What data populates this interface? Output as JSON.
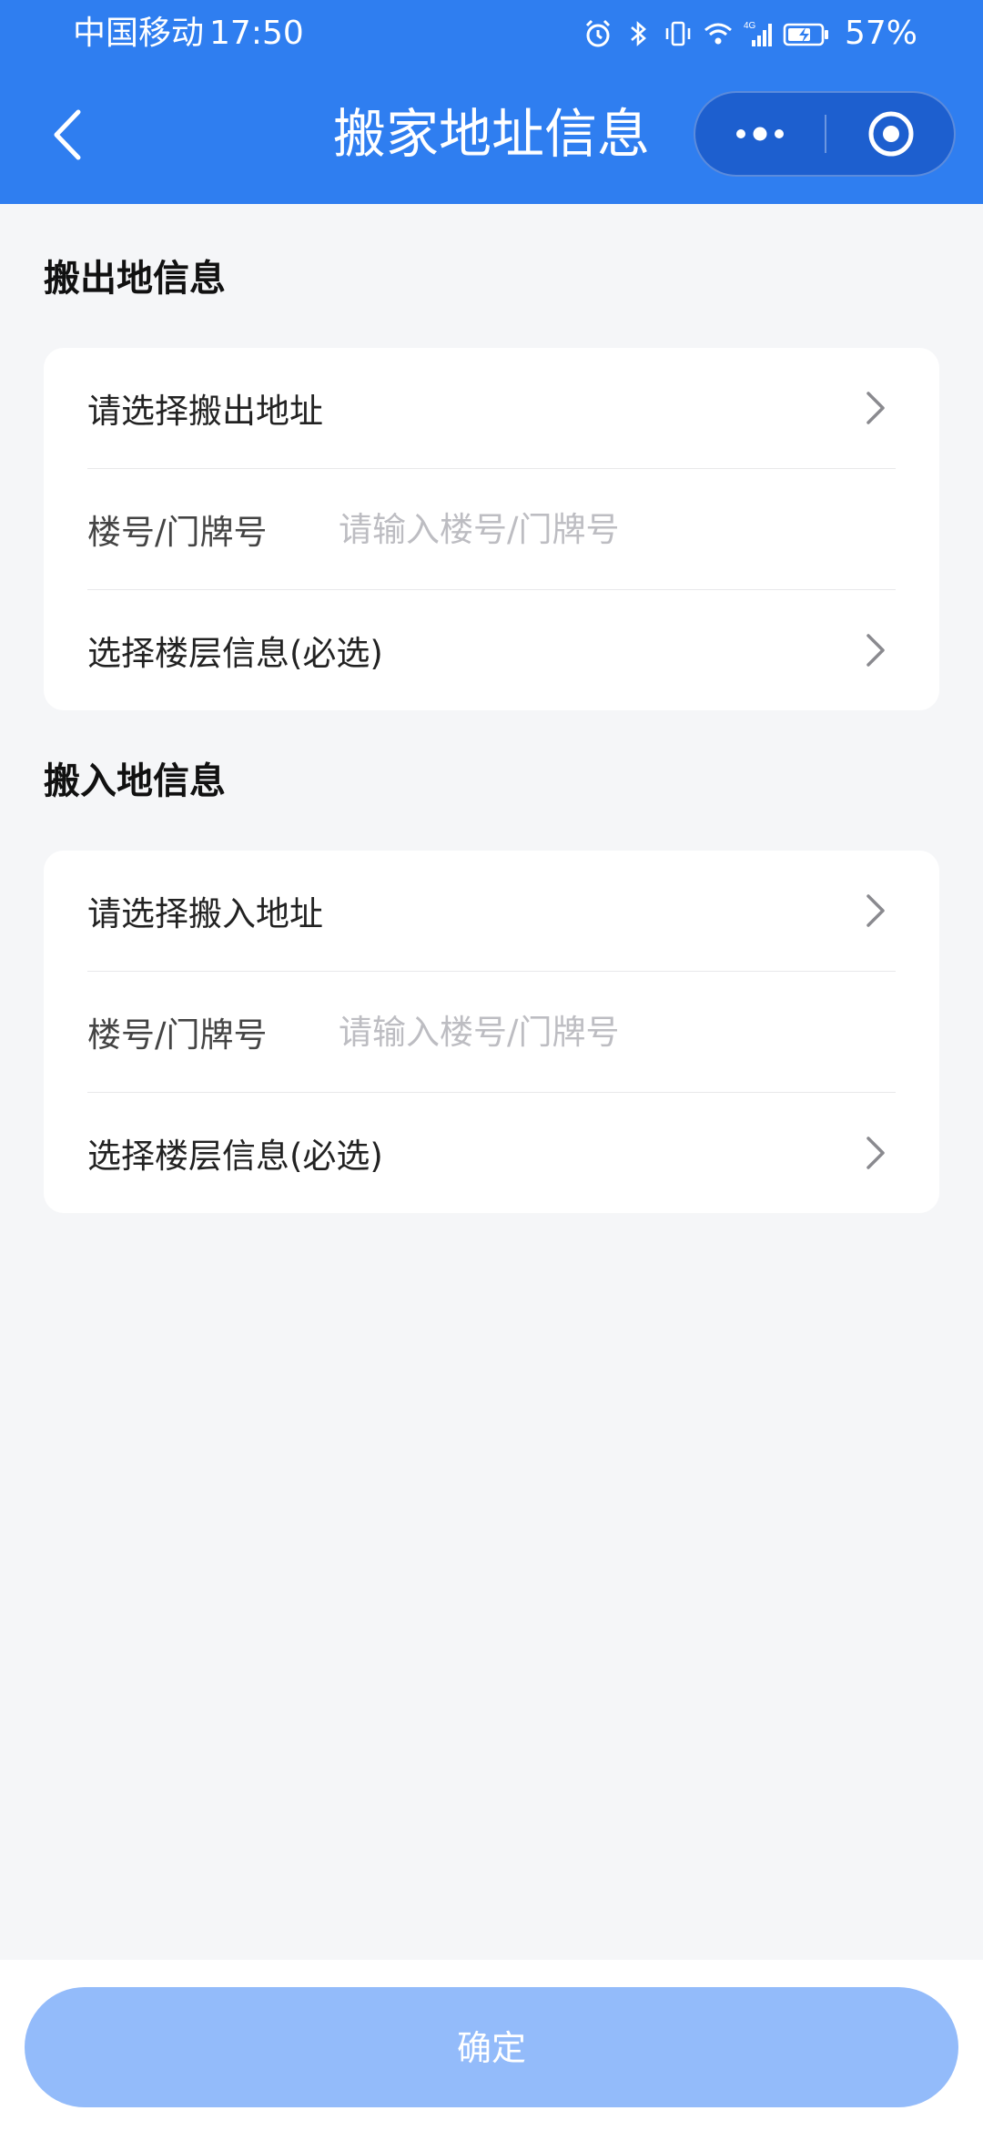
{
  "status_bar": {
    "carrier": "中国移动",
    "time": "17:50",
    "network": "4G",
    "battery": "57%"
  },
  "nav": {
    "title": "搬家地址信息",
    "back_icon": "chevron-left-icon",
    "more_icon": "more-dots-icon",
    "close_icon": "target-circle-icon"
  },
  "move_out": {
    "section_title": "搬出地信息",
    "address_label": "请选择搬出地址",
    "building_label": "楼号/门牌号",
    "building_placeholder": "请输入楼号/门牌号",
    "floor_label": "选择楼层信息(必选)"
  },
  "move_in": {
    "section_title": "搬入地信息",
    "address_label": "请选择搬入地址",
    "building_label": "楼号/门牌号",
    "building_placeholder": "请输入楼号/门牌号",
    "floor_label": "选择楼层信息(必选)"
  },
  "footer": {
    "confirm_label": "确定"
  },
  "colors": {
    "header_bg": "#2f7ef0",
    "button_disabled": "#93bbfa",
    "page_bg": "#f5f6f8"
  }
}
